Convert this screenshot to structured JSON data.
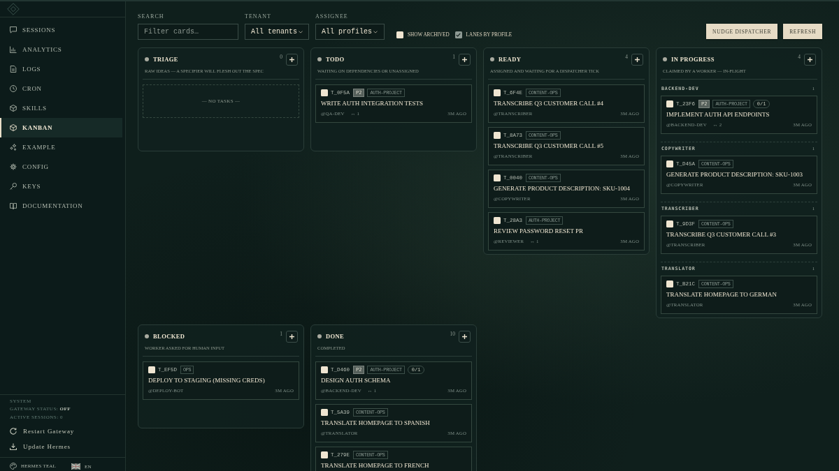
{
  "sidebar": {
    "nav": [
      {
        "label": "SESSIONS",
        "selected": false
      },
      {
        "label": "ANALYTICS",
        "selected": false
      },
      {
        "label": "LOGS",
        "selected": false
      },
      {
        "label": "CRON",
        "selected": false
      },
      {
        "label": "SKILLS",
        "selected": false
      },
      {
        "label": "KANBAN",
        "selected": true
      },
      {
        "label": "EXAMPLE",
        "selected": false
      },
      {
        "label": "CONFIG",
        "selected": false
      },
      {
        "label": "KEYS",
        "selected": false
      },
      {
        "label": "DOCUMENTATION",
        "selected": false
      }
    ],
    "system": {
      "heading": "SYSTEM",
      "gateway_status": "GATEWAY STATUS: **OFF**",
      "active_sessions": "ACTIVE SESSIONS: 0"
    },
    "actions": [
      "Restart Gateway",
      "Update Hermes"
    ],
    "footer": {
      "theme": "HERMES TEAL",
      "language": "EN"
    }
  },
  "filters": {
    "search": {
      "label": "SEARCH",
      "placeholder": "Filter cards…"
    },
    "tenant": {
      "label": "TENANT",
      "value": "All tenants"
    },
    "assignee": {
      "label": "ASSIGNEE",
      "value": "All profiles"
    },
    "toggles": [
      {
        "label": "SHOW ARCHIVED",
        "checked": false
      },
      {
        "label": "LANES BY PROFILE",
        "checked": true
      }
    ]
  },
  "buttons": [
    "NUDGE DISPATCHER",
    "REFRESH"
  ],
  "columns": [
    {
      "title": "TRIAGE",
      "count": "0",
      "description": "RAW IDEAS — A SPECIFIER WILL FLESH OUT THE SPEC",
      "empty": "— NO TASKS —"
    },
    {
      "title": "TODO",
      "count": "1",
      "description": "WAITING ON DEPENDENCIES OR UNASSIGNED",
      "cards": [
        {
          "id": "T_0F5A",
          "checked": false,
          "priority": "P2",
          "tag": "AUTH-PROJECT",
          "title": "WRITE AUTH INTEGRATION TESTS",
          "assignee": "@QA-DEV",
          "dependencies": "↔ 1",
          "age": "3M AGO"
        }
      ]
    },
    {
      "title": "READY",
      "count": "4",
      "description": "ASSIGNED AND WAITING FOR A DISPATCHER TICK",
      "cards": [
        {
          "id": "T_6F4E",
          "checked": false,
          "tag": "CONTENT-OPS",
          "title": "TRANSCRIBE Q3 CUSTOMER CALL #4",
          "assignee": "@TRANSCRIBER",
          "age": "3M AGO"
        },
        {
          "id": "T_8A73",
          "checked": false,
          "tag": "CONTENT-OPS",
          "title": "TRANSCRIBE Q3 CUSTOMER CALL #5",
          "assignee": "@TRANSCRIBER",
          "age": "3M AGO"
        },
        {
          "id": "T_0040",
          "checked": false,
          "tag": "CONTENT-OPS",
          "title": "GENERATE PRODUCT DESCRIPTION: SKU-1004",
          "assignee": "@COPYWRITER",
          "age": "3M AGO"
        },
        {
          "id": "T_28A3",
          "checked": false,
          "tag": "AUTH-PROJECT",
          "title": "REVIEW PASSWORD RESET PR",
          "assignee": "@REVIEWER",
          "dependencies": "↔ 1",
          "age": "3M AGO"
        }
      ]
    },
    {
      "title": "IN PROGRESS",
      "count": "4",
      "description": "CLAIMED BY A WORKER — IN-FLIGHT",
      "lanes": [
        {
          "name": "BACKEND-DEV",
          "count": "1",
          "cards": [
            {
              "id": "T_23F6",
              "checked": false,
              "priority": "P2",
              "tag": "AUTH-PROJECT",
              "progress": "0/1",
              "title": "IMPLEMENT AUTH API ENDPOINTS",
              "assignee": "@BACKEND-DEV",
              "dependencies": "↔ 2",
              "age": "3M AGO"
            }
          ]
        },
        {
          "name": "COPYWRITER",
          "count": "1",
          "cards": [
            {
              "id": "T_D45A",
              "checked": false,
              "tag": "CONTENT-OPS",
              "title": "GENERATE PRODUCT DESCRIPTION: SKU-1003",
              "assignee": "@COPYWRITER",
              "age": "3M AGO"
            }
          ]
        },
        {
          "name": "TRANSCRIBER",
          "count": "1",
          "cards": [
            {
              "id": "T_9D3F",
              "checked": false,
              "tag": "CONTENT-OPS",
              "title": "TRANSCRIBE Q3 CUSTOMER CALL #3",
              "assignee": "@TRANSCRIBER",
              "age": "3M AGO"
            }
          ]
        },
        {
          "name": "TRANSLATOR",
          "count": "1",
          "cards": [
            {
              "id": "T_B21C",
              "checked": false,
              "tag": "CONTENT-OPS",
              "title": "TRANSLATE HOMEPAGE TO GERMAN",
              "assignee": "@TRANSLATOR",
              "age": "3M AGO"
            }
          ]
        }
      ]
    },
    {
      "title": "BLOCKED",
      "count": "1",
      "description": "WORKER ASKED FOR HUMAN INPUT",
      "cards": [
        {
          "id": "T_EF5D",
          "checked": false,
          "tag": "OPS",
          "title": "DEPLOY TO STAGING (MISSING CREDS)",
          "assignee": "@DEPLOY-BOT",
          "age": "3M AGO"
        }
      ]
    },
    {
      "title": "DONE",
      "count": "10",
      "description": "COMPLETED",
      "cards": [
        {
          "id": "T_D460",
          "checked": false,
          "priority": "P2",
          "tag": "AUTH-PROJECT",
          "progress": "0/1",
          "title": "DESIGN AUTH SCHEMA",
          "assignee": "@BACKEND-DEV",
          "dependencies": "↔ 1",
          "age": "3M AGO"
        },
        {
          "id": "T_5A39",
          "checked": false,
          "tag": "CONTENT-OPS",
          "title": "TRANSLATE HOMEPAGE TO SPANISH",
          "assignee": "@TRANSLATOR",
          "age": "3M AGO"
        },
        {
          "id": "T_279E",
          "checked": false,
          "tag": "CONTENT-OPS",
          "title": "TRANSLATE HOMEPAGE TO FRENCH"
        }
      ]
    }
  ]
}
